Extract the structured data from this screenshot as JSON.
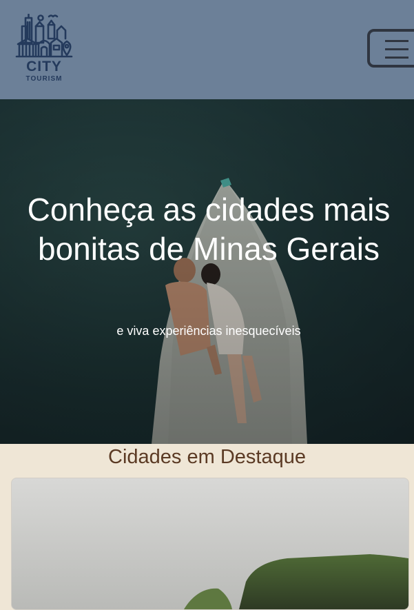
{
  "brand": {
    "name": "CITY",
    "tagline": "TOURISM"
  },
  "nav": {
    "menu_icon": "hamburger-icon"
  },
  "hero": {
    "title": "Conheça as cidades mais bonitas de Minas Gerais",
    "subtitle": "e viva experiências inesquecíveis"
  },
  "featured": {
    "title": "Cidades em Destaque"
  },
  "colors": {
    "navbar": "#6c8098",
    "logo": "#243a5c",
    "page_background": "#efe6d6",
    "section_title": "#5b3a24",
    "hero_overlay": "#1e3638"
  }
}
